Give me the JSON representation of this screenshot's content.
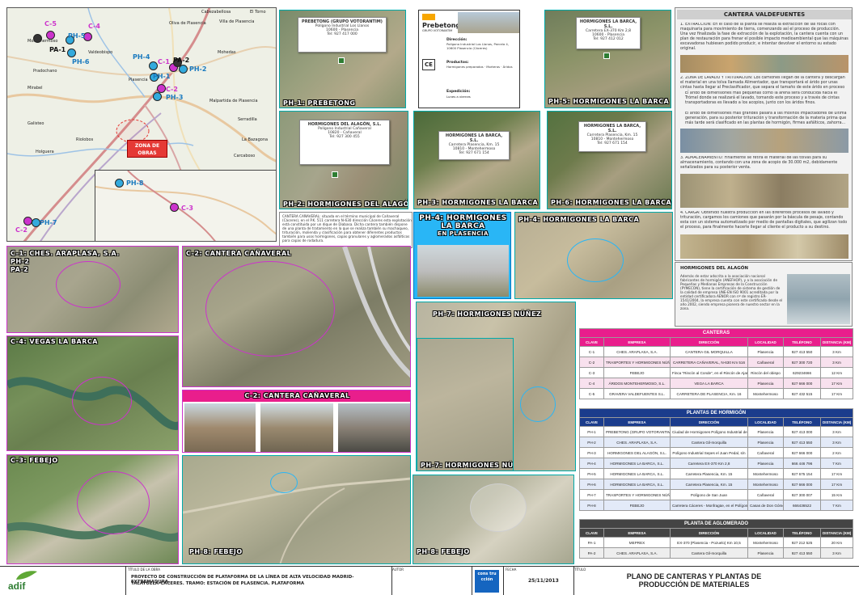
{
  "map_overview": {
    "towns": [
      "Cabezabellosa",
      "El Torno",
      "Villa de Plasencia",
      "Oliva de Plasencia",
      "Montehermoso",
      "Valdeobispo",
      "Pradochano",
      "Mirabel",
      "Plasencia",
      "Malpartida de Plasencia",
      "Serradilla",
      "Holguera",
      "Galisteo",
      "Riolobos",
      "La Bazagona",
      "Mohedas",
      "Carcaboso"
    ],
    "markers": [
      {
        "id": "C-5",
        "color": "#cc33cc"
      },
      {
        "id": "C-4",
        "color": "#cc33cc"
      },
      {
        "id": "PA-1",
        "color": "#333333"
      },
      {
        "id": "PH-5",
        "color": "#33aadd"
      },
      {
        "id": "PH-6",
        "color": "#33aadd"
      },
      {
        "id": "PH-4",
        "color": "#33aadd"
      },
      {
        "id": "C-1",
        "color": "#cc33cc"
      },
      {
        "id": "PA-2",
        "color": "#333333"
      },
      {
        "id": "PH-2",
        "color": "#33aadd"
      },
      {
        "id": "PH-1",
        "color": "#33aadd"
      },
      {
        "id": "C-2",
        "color": "#cc33cc"
      },
      {
        "id": "PH-3",
        "color": "#33aadd"
      },
      {
        "id": "C-2 ",
        "color": "#cc33cc"
      },
      {
        "id": "PH-7",
        "color": "#33aadd"
      }
    ],
    "inset_markers": [
      {
        "id": "PH-8",
        "color": "#33aadd"
      },
      {
        "id": "C-3",
        "color": "#cc33cc"
      }
    ],
    "obras_label": "ZONA DE OBRAS"
  },
  "panels": {
    "ph1": "PH-1: PREBETONG",
    "ph2": "PH-2: HORMIGONES DEL ALAGÓN",
    "ph3": "PH-3: HORMIGONES LA BARCA",
    "ph4a": "PH-4: HORMIGONES LA BARCA",
    "ph4b": "PH-4: HORMIGONES LA BARCA",
    "ph5": "PH-5: HORMIGONES LA BARCA",
    "ph6": "PH-6: HORMIGONES LA BARCA",
    "ph7a": "PH-7: HORMIGONES NÚÑEZ",
    "ph7b": "PH-7: HORMIGONES NÚÑEZ",
    "ph8a": "PH-8: FEBEJO",
    "ph8b": "PH-8: FEBEJO",
    "c1": "C-1: CHES. ARAPLASA, S.A.",
    "c1b": "PH-2",
    "c1c": "PA-2",
    "c2": "C-2: CANTERA CAÑAVERAL",
    "c2b": "C-2: CANTERA CAÑAVERAL",
    "c4": "C-4: VEGAS LA BARCA",
    "c3": "C-3: FEBEJO",
    "ph4_plasencia_line1": "PH-4: HORMIGONES",
    "ph4_plasencia_line2": "LA BARCA",
    "ph4_plasencia_line3": "EN PLASENCIA"
  },
  "popups": {
    "prebetong": {
      "name": "PREBETONG (GRUPO VOTORANTIM)",
      "line2": "Polígono Industrial Los Llanos",
      "line3": "10600 - Plasencia",
      "line4": "Tel: 927 417 000"
    },
    "alagon": {
      "name": "HORMIGONES DEL ALAGÓN, S.L.",
      "line2": "Polígono Industrial Cañaveral",
      "line3": "10820 - Cañaveral",
      "line4": "Tel: 927 300 455"
    },
    "barca1": {
      "name": "HORMIGONES LA BARCA, S.L.",
      "line2": "Carretera EX-370 Km 2,8",
      "line3": "10600 - Plasencia",
      "line4": "Tel: 927 412 012"
    },
    "barca2": {
      "name": "HORMIGONES LA BARCA, S.L.",
      "line2": "Carretera Plasencia, Km. 15",
      "line3": "10810 - Montehermoso",
      "line4": "Tel: 927 671 154"
    },
    "barca3": {
      "name": "HORMIGONES LA BARCA, S.L.",
      "line2": "Carretera Plasencia, Km. 15",
      "line3": "10810 - Montehermoso",
      "line4": "Tel: 927 671 154"
    }
  },
  "brochure": {
    "brand": "Prebetong",
    "sub": "GRUPO VOTORANTIM",
    "direccion_label": "Dirección:",
    "direccion": "Polígono Industrial Los Llanos, Parcela 4, 10600 Plasencia (Cáceres)",
    "productos_label": "Productos:",
    "productos": "Hormigones preparados · Morteros · Áridos",
    "expedicion_label": "Expedición:",
    "expedicion": "Lunes a viernes"
  },
  "cantera_valdefuentes": {
    "title": "CANTERA VALDEFUENTES",
    "p1": "1. EXTRACCIÓN: En el caso de la planta se realiza la extracción de las rocas con maquinaria para movimiento de tierra, comenzando así el proceso de producción. Una vez finalizada la fase de extracción de la explotación, la cantera cuenta con un plan de restauración para frenar el posible impacto medioambiental que las máquinas excavadoras hubiesen podido producir, e intentar devolver el entorno su estado original.",
    "p2": "2. ZONA DE LAVADO Y TRITURACIÓN: Los camiones llegan de la cantera y descargan el material en una tolva llamada Alimentador, que transportará el árido por unas cintas hasta llegar al Preclasificador, que separa el tamaño de este árido en proceso en dos:",
    "p2a": "El árido de dimensiones más pequeñas como la arena será conducida hacia el Trómel donde se realizará el lavado, tomando este proceso y a través de cintas transportadoras es llevado a los acopios, junto con los áridos finos.",
    "p2b": "El árido de dimensiones más grandes pasará a las molinos impactadores de última generación, para su posterior trituración y transformación de la materia prima que más tarde será clasificado en las plantas de hormigón, firmes asfálticos, zahorra...",
    "p3": "3. ALMACENAMIENTO: Finalmente se retira el material de las tolvas para su almacenamiento, contando con una zona de acopio de 30.000 m2, debidamente señalizados para su posterior venta.",
    "p4": "4. CARGA: Obtenido nuestra producción en las diferentes procesos de lavado y trituración, cargamos los camiones que pasarán por la báscula de pesaje, contando esta con un sistema automatizado por medio de pantallas digitales, que agilizan todo el proceso, para finalmente hacerle llegar al cliente el producto a su destino."
  },
  "alagon_info": {
    "title": "HORMIGONES DEL ALAGÓN",
    "text": "Además de estar adscrita a la asociación nacional fabricantes de hormigón (ANEFHOP), y a la asociación de Pequeñas y Medianas Empresas de la Construcción (PYMECON), tiene la certificación de sistema de gestión de la calidad de empresa UNE-EN ISO 9001 acreditada por la entidad certificadora AENOR con nº de registro ER-1541/2004, la empresa cuenta con este certificado desde el año 2002, siendo empresa pionera de nuestro sector en la zona."
  },
  "canaveral_text": "CANTERA CAÑAVERAL: situada en el término municipal de Cañaveral (Cáceres), en el P.K. 511 carretera N-630 dirección Cáceres esta explotación está constituida por un dique de Diabasa. Dicha cantera también dispone de una planta de tratamiento en la que se realiza también su machaqueo, trituración, molienda y clasificación para obtener diferentes productos también para usos hormigones, capas granulares y aglomerados asfálticos para capas de rodadura.",
  "tables": {
    "columns": [
      "CLAVE",
      "EMPRESA",
      "DIRECCIÓN",
      "LOCALIDAD",
      "TELÉFONO",
      "DISTANCIA (KM)"
    ],
    "canteras": {
      "title": "CANTERAS",
      "header_color": "#e91e8c",
      "rows": [
        [
          "C-1",
          "CHES. ARAPLASA, S.A.",
          "CANTERA GIL MORQUILLA",
          "Plasencia",
          "927 413 550",
          "3 Km"
        ],
        [
          "C-2",
          "TRASPORTES Y HORMIGONES NÚÑEZ",
          "CARRETERA CAÑAVERAL, N-630 Km 516",
          "Cañaveral",
          "927 300 720",
          "3 Km"
        ],
        [
          "C-3",
          "FEBEJO",
          "Finca \"Rincón al Conde\", en el Rincón de Ajaraz, Situada de \"El ensopo\"",
          "Rincón del obispo",
          "629234666",
          "12 Km"
        ],
        [
          "C-4",
          "ÁRIDOS MONTEHERMOSO, S.L.",
          "VEGA LA BARCA",
          "Plasencia",
          "927 666 000",
          "17 Km"
        ],
        [
          "C-5",
          "GRAVERA VALDEFUENTES S.L.",
          "CARRETERA DE PLASENCIA, Km. 16",
          "Montehermoso",
          "927 432 515",
          "17 Km"
        ]
      ]
    },
    "plantas_hormigon": {
      "title": "PLANTAS DE HORMIGÓN",
      "header_color": "#1b3c8c",
      "rows": [
        [
          "PH-1",
          "PREBETONG (GRUPO VOTORANTIM)",
          "Ciudad de Hormigones Polígono Industrial de Plasencia P-505",
          "Plasencia",
          "927 413 000",
          "3 Km"
        ],
        [
          "PH-2",
          "CHES. ARAPLASA, S.A.",
          "Cantera Gil-morquilla",
          "Plasencia",
          "927 413 550",
          "3 Km"
        ],
        [
          "PH-3",
          "HORMIGONES DEL ALAGÓN, S.L.",
          "Polígono Industrial Sepes el Juan Pedal, s/n",
          "Cañaveral",
          "927 666 000",
          "2 Km"
        ],
        [
          "PH-4",
          "HORMIGONES LA BARCA, S.L.",
          "Carretera EX-370 Km 2,8",
          "Plasencia",
          "666 446 796",
          "7 Km"
        ],
        [
          "PH-5",
          "HORMIGONES LA BARCA, S.L.",
          "Carretera Plasencia, Km. 15",
          "Montehermoso",
          "927 675 154",
          "17 Km"
        ],
        [
          "PH-6",
          "HORMIGONES LA BARCA, S.L.",
          "Carretera Plasencia, Km. 15",
          "Montehermoso",
          "927 666 000",
          "17 Km"
        ],
        [
          "PH-7",
          "TRASPORTES Y HORMIGONES NÚÑEZ",
          "Polígono de San Juan",
          "Cañaveral",
          "927 300 007",
          "15 Km"
        ],
        [
          "PH-8",
          "FEBEJO",
          "Carretera Cáceres - Monfragüe, en el Polígono de Casas de Don Gómez",
          "Casas de Don Gómez",
          "666436522",
          "7 Km"
        ]
      ]
    },
    "planta_aglomerado": {
      "title": "PLANTA DE AGLOMERADO",
      "header_color": "#444444",
      "rows": [
        [
          "PA-1",
          "MEPREX",
          "EX-370 (Plasencia - Pozuelo) Km 10,5",
          "Montehermoso",
          "927 212 525",
          "20 Km"
        ],
        [
          "PA-2",
          "CHES. ARAPLASA, S.A.",
          "Cantera Gil-morquilla",
          "Plasencia",
          "927 413 550",
          "3 Km"
        ]
      ]
    }
  },
  "footer": {
    "logo": "adif",
    "titulo_label": "TÍTULO DE LA OBRA",
    "titulo": "PROYECTO DE CONSTRUCCIÓN DE PLATAFORMA DE LA LÍNEA DE ALTA VELOCIDAD MADRID-EXTREMADURA.",
    "titulo2": "TALAYUELA-CÁCERES. TRAMO: ESTACIÓN DE PLASENCIA. PLATAFORMA",
    "autor_label": "AUTOR",
    "fecha_label": "FECHA",
    "fecha": "25/11/2013",
    "titulo_plano_label": "TÍTULO",
    "plano": "PLANO DE CANTERAS Y PLANTAS DE",
    "plano2": "PRODUCCIÓN DE MATERIALES",
    "sello": "cons tru cción"
  }
}
